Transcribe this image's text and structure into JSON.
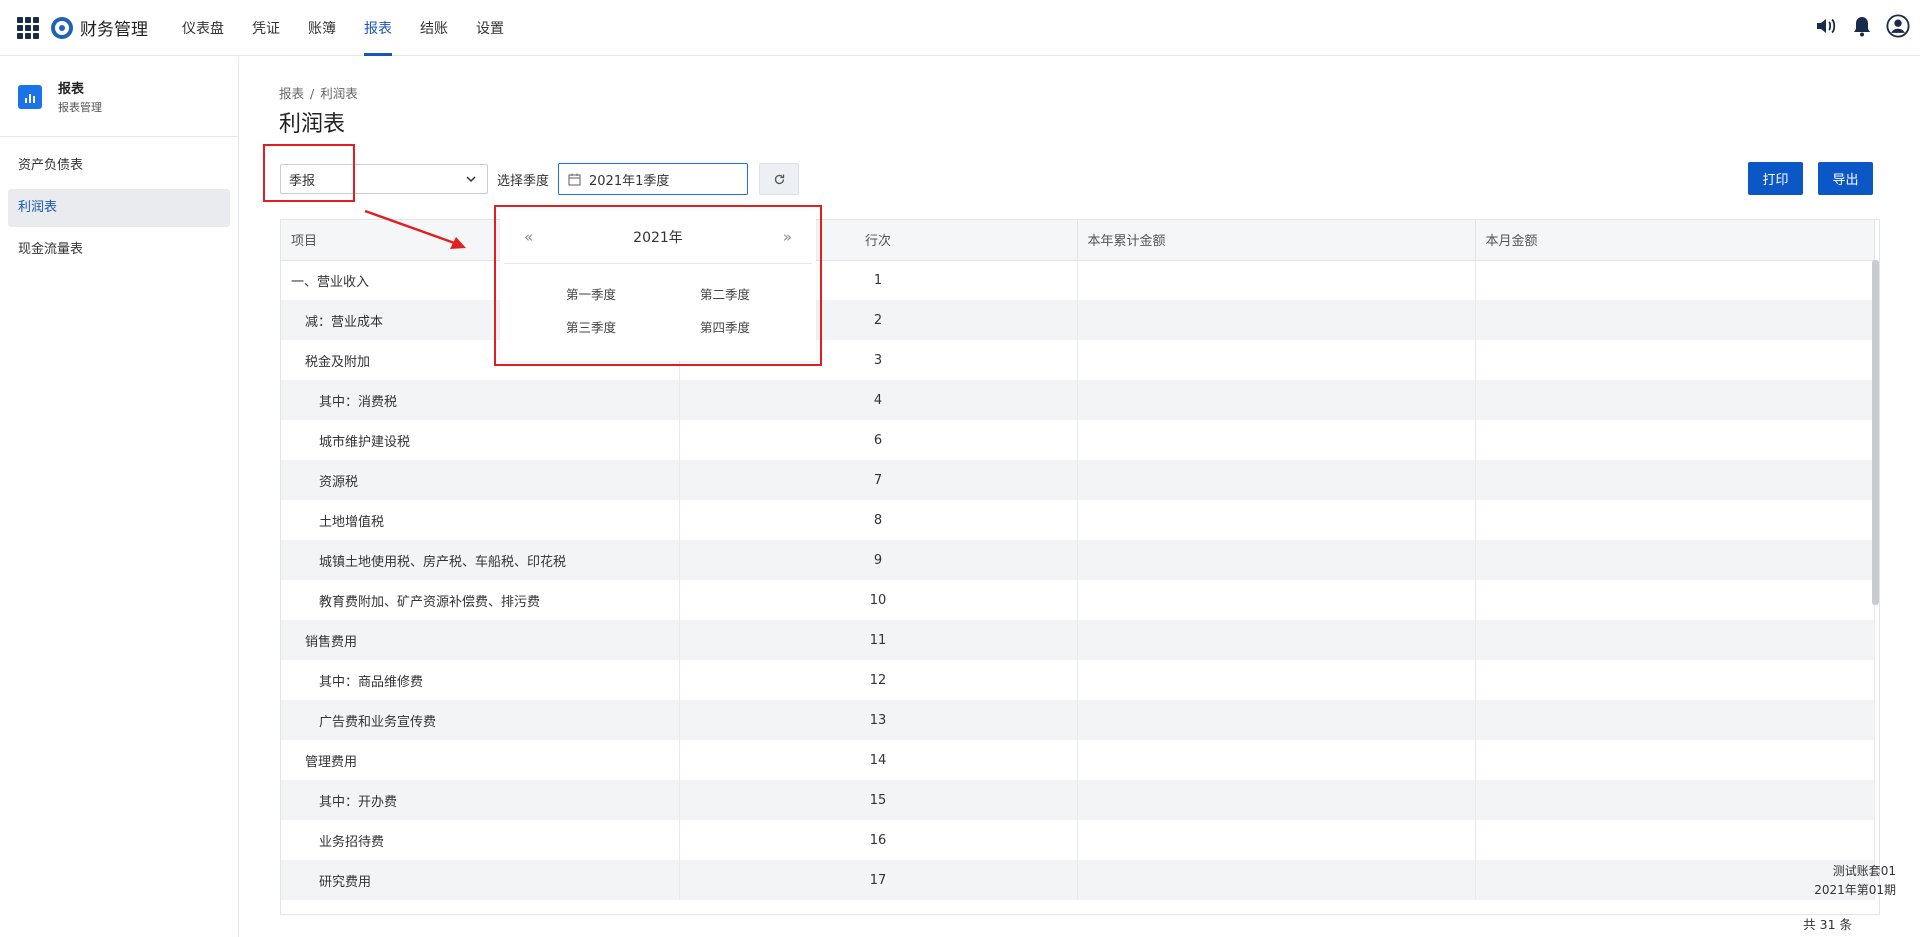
{
  "app": {
    "title": "财务管理"
  },
  "nav": {
    "items": [
      {
        "label": "仪表盘"
      },
      {
        "label": "凭证"
      },
      {
        "label": "账簿"
      },
      {
        "label": "报表",
        "active": true
      },
      {
        "label": "结账"
      },
      {
        "label": "设置"
      }
    ]
  },
  "header_icons": [
    "volume-icon",
    "bell-icon",
    "user-icon"
  ],
  "sidebar": {
    "title": "报表",
    "subtitle": "报表管理",
    "items": [
      {
        "label": "资产负债表"
      },
      {
        "label": "利润表",
        "active": true
      },
      {
        "label": "现金流量表"
      }
    ]
  },
  "breadcrumb": {
    "root": "报表",
    "sep": "/",
    "current": "利润表"
  },
  "page": {
    "title": "利润表"
  },
  "toolbar": {
    "period_type": "季报",
    "quarter_label": "选择季度",
    "quarter_value": "2021年1季度",
    "print_label": "打印",
    "export_label": "导出"
  },
  "quarter_picker": {
    "year": "2021年",
    "quarters": [
      "第一季度",
      "第二季度",
      "第三季度",
      "第四季度"
    ]
  },
  "table": {
    "headers": [
      "项目",
      "行次",
      "本年累计金额",
      "本月金额"
    ],
    "rows": [
      {
        "item": "一、营业收入",
        "line": "1",
        "level": 0
      },
      {
        "item": "减：营业成本",
        "line": "2",
        "level": 1
      },
      {
        "item": "税金及附加",
        "line": "3",
        "level": 1
      },
      {
        "item": "其中：消费税",
        "line": "4",
        "level": 2
      },
      {
        "item": "城市维护建设税",
        "line": "6",
        "level": 2
      },
      {
        "item": "资源税",
        "line": "7",
        "level": 2
      },
      {
        "item": "土地增值税",
        "line": "8",
        "level": 2
      },
      {
        "item": "城镇土地使用税、房产税、车船税、印花税",
        "line": "9",
        "level": 2
      },
      {
        "item": "教育费附加、矿产资源补偿费、排污费",
        "line": "10",
        "level": 2
      },
      {
        "item": "销售费用",
        "line": "11",
        "level": 1
      },
      {
        "item": "其中：商品维修费",
        "line": "12",
        "level": 2
      },
      {
        "item": "广告费和业务宣传费",
        "line": "13",
        "level": 2
      },
      {
        "item": "管理费用",
        "line": "14",
        "level": 1
      },
      {
        "item": "其中：开办费",
        "line": "15",
        "level": 2
      },
      {
        "item": "业务招待费",
        "line": "16",
        "level": 2
      },
      {
        "item": "研究费用",
        "line": "17",
        "level": 2
      }
    ]
  },
  "footer": {
    "account": "测试账套01",
    "period": "2021年第01期",
    "count": "共 31 条"
  }
}
